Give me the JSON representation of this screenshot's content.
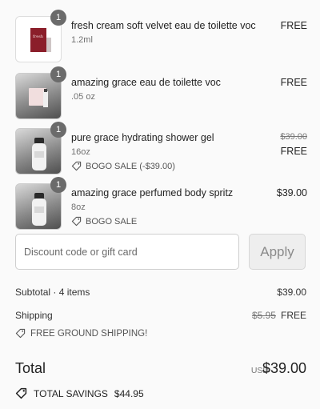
{
  "items": [
    {
      "qty": "1",
      "name": "fresh cream soft velvet eau de toilette voc",
      "variant": "1.2ml",
      "price": "FREE",
      "thumb_icon": "perfume-sample-card-icon"
    },
    {
      "qty": "1",
      "name": "amazing grace eau de toilette voc",
      "variant": ".05 oz",
      "price": "FREE",
      "thumb_icon": "perfume-vial-icon"
    },
    {
      "qty": "1",
      "name": "pure grace hydrating shower gel",
      "variant": "16oz",
      "old_price": "$39.00",
      "price": "FREE",
      "promo": "BOGO SALE (-$39.00)",
      "thumb_icon": "bottle-icon"
    },
    {
      "qty": "1",
      "name": "amazing grace perfumed body spritz",
      "variant": "8oz",
      "price": "$39.00",
      "promo": "BOGO SALE",
      "thumb_icon": "bottle-icon"
    }
  ],
  "discount": {
    "placeholder": "Discount code or gift card",
    "apply_label": "Apply"
  },
  "summary": {
    "subtotal_label": "Subtotal · 4 items",
    "subtotal_value": "$39.00",
    "shipping_label": "Shipping",
    "shipping_old": "$5.95",
    "shipping_value": "FREE",
    "shipping_note": "FREE GROUND SHIPPING!",
    "total_label": "Total",
    "currency": "USD",
    "total_value": "$39.00",
    "savings_label": "TOTAL SAVINGS",
    "savings_value": "$44.95"
  },
  "colors": {
    "badge": "#6b6b6b",
    "accent_text": "#222222"
  }
}
